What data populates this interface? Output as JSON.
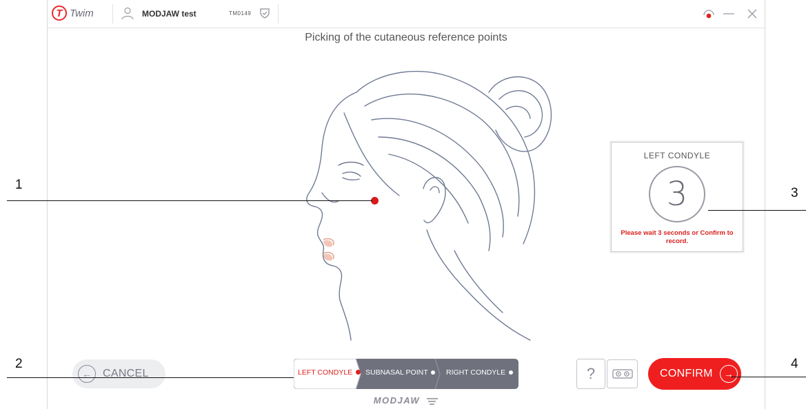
{
  "app": {
    "logo_letter": "T",
    "logo_name": "Twim"
  },
  "titlebar": {
    "patient_name": "MODJAW test",
    "patient_id": "TM0149"
  },
  "heading": "Picking of the cutaneous reference points",
  "countdown_card": {
    "title": "LEFT CONDYLE",
    "count": "3",
    "message": "Please wait 3 seconds or Confirm to record."
  },
  "footer": {
    "cancel_label": "CANCEL",
    "confirm_label": "CONFIRM",
    "help_label": "?",
    "brand": "MODJAW"
  },
  "steps": [
    {
      "label": "LEFT CONDYLE",
      "active": true
    },
    {
      "label": "SUBNASAL POINT",
      "active": false
    },
    {
      "label": "RIGHT CONDYLE",
      "active": false
    }
  ],
  "callouts": [
    "1",
    "2",
    "3",
    "4"
  ],
  "colors": {
    "accent": "#f01f1f",
    "step_inactive": "#6f717d",
    "text_muted": "#7a7a86"
  },
  "icons": [
    "user-icon",
    "shield-check-icon",
    "record-icon",
    "minimize-icon",
    "close-icon",
    "arrow-left-icon",
    "arrow-right-icon",
    "camera-icon"
  ]
}
